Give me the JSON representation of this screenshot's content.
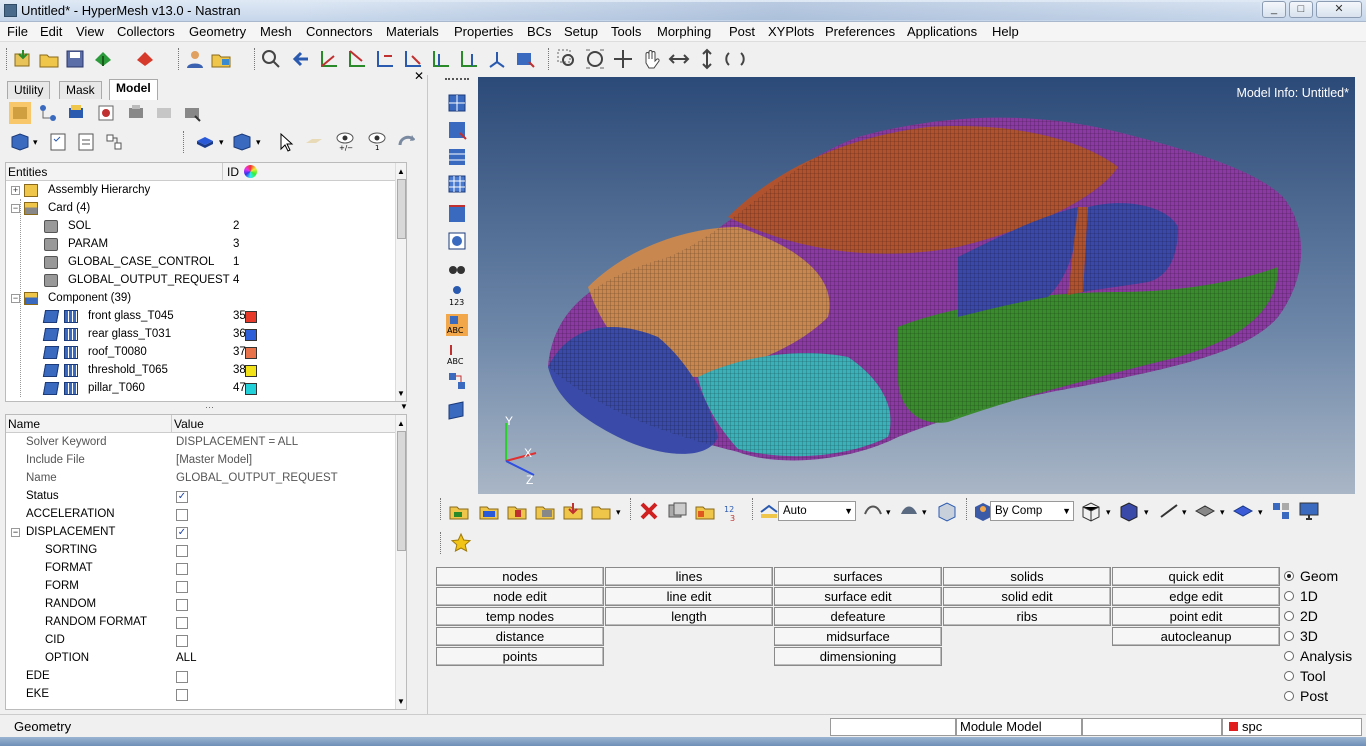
{
  "window": {
    "title": "Untitled* - HyperMesh v13.0 - Nastran",
    "min": "_",
    "max": "□",
    "close": "✕"
  },
  "menu": [
    "File",
    "Edit",
    "View",
    "Collectors",
    "Geometry",
    "Mesh",
    "Connectors",
    "Materials",
    "Properties",
    "BCs",
    "Setup",
    "Tools",
    "Morphing",
    "Post",
    "XYPlots",
    "Preferences",
    "Applications",
    "Help"
  ],
  "browser": {
    "tabs": [
      "Utility",
      "Mask",
      "Model"
    ],
    "active_tab": "Model",
    "close": "✕",
    "tree_headers": {
      "entities": "Entities",
      "id": "ID"
    },
    "tree": [
      {
        "exp": "+",
        "label": "Assembly Hierarchy",
        "id": "",
        "color": null,
        "level": 0,
        "icon": "assembly-icon"
      },
      {
        "exp": "−",
        "label": "Card (4)",
        "id": "",
        "color": null,
        "level": 0,
        "icon": "folder-icon"
      },
      {
        "exp": "",
        "label": "SOL",
        "id": "2",
        "color": null,
        "level": 1,
        "icon": "card-icon"
      },
      {
        "exp": "",
        "label": "PARAM",
        "id": "3",
        "color": null,
        "level": 1,
        "icon": "card-icon"
      },
      {
        "exp": "",
        "label": "GLOBAL_CASE_CONTROL",
        "id": "1",
        "color": null,
        "level": 1,
        "icon": "card-icon"
      },
      {
        "exp": "",
        "label": "GLOBAL_OUTPUT_REQUEST",
        "id": "4",
        "color": null,
        "level": 1,
        "icon": "card-icon"
      },
      {
        "exp": "−",
        "label": "Component (39)",
        "id": "",
        "color": null,
        "level": 0,
        "icon": "component-folder-icon"
      },
      {
        "exp": "",
        "label": "front glass_T045",
        "id": "35",
        "color": "#e83a2a",
        "level": 2,
        "icon": "component-icon"
      },
      {
        "exp": "",
        "label": "rear glass_T031",
        "id": "36",
        "color": "#2f5fd8",
        "level": 2,
        "icon": "component-icon"
      },
      {
        "exp": "",
        "label": "roof_T0080",
        "id": "37",
        "color": "#e8734a",
        "level": 2,
        "icon": "component-icon"
      },
      {
        "exp": "",
        "label": "threshold_T065",
        "id": "38",
        "color": "#f2e21a",
        "level": 2,
        "icon": "component-icon"
      },
      {
        "exp": "",
        "label": "pillar_T060",
        "id": "47",
        "color": "#21d0d8",
        "level": 2,
        "icon": "component-icon"
      }
    ],
    "prop_headers": {
      "name": "Name",
      "value": "Value"
    },
    "props": [
      {
        "name": "Solver Keyword",
        "value": "DISPLACEMENT = ALL",
        "type": "text",
        "indent": 1,
        "dim": true
      },
      {
        "name": "Include File",
        "value": "[Master Model]",
        "type": "text",
        "indent": 1,
        "dim": true
      },
      {
        "name": "Name",
        "value": "GLOBAL_OUTPUT_REQUEST",
        "type": "text",
        "indent": 1,
        "dim": true
      },
      {
        "name": "Status",
        "value": "✓",
        "type": "check",
        "indent": 1,
        "dim": false
      },
      {
        "name": "ACCELERATION",
        "value": "",
        "type": "check",
        "indent": 1,
        "dim": false
      },
      {
        "name": "DISPLACEMENT",
        "value": "✓",
        "type": "check",
        "indent": 1,
        "dim": false,
        "exp": "−"
      },
      {
        "name": "SORTING",
        "value": "",
        "type": "check",
        "indent": 2,
        "dim": false
      },
      {
        "name": "FORMAT",
        "value": "",
        "type": "check",
        "indent": 2,
        "dim": false
      },
      {
        "name": "FORM",
        "value": "",
        "type": "check",
        "indent": 2,
        "dim": false
      },
      {
        "name": "RANDOM",
        "value": "",
        "type": "check",
        "indent": 2,
        "dim": false
      },
      {
        "name": "RANDOM FORMAT",
        "value": "",
        "type": "check",
        "indent": 2,
        "dim": false
      },
      {
        "name": "CID",
        "value": "",
        "type": "check",
        "indent": 2,
        "dim": false
      },
      {
        "name": "OPTION",
        "value": "ALL",
        "type": "text",
        "indent": 2,
        "dim": false
      },
      {
        "name": "EDE",
        "value": "",
        "type": "check",
        "indent": 1,
        "dim": false
      },
      {
        "name": "EKE",
        "value": "",
        "type": "check",
        "indent": 1,
        "dim": false
      }
    ]
  },
  "viewport": {
    "model_info": "Model Info: Untitled*",
    "axis_labels": {
      "y": "Y",
      "x": "X",
      "z": "Z"
    }
  },
  "bottom_toolbar": {
    "shading_combo": "Auto",
    "color_combo": "By Comp"
  },
  "panel_buttons": [
    [
      "nodes",
      "lines",
      "surfaces",
      "solids",
      "quick edit"
    ],
    [
      "node edit",
      "line edit",
      "surface edit",
      "solid edit",
      "edge edit"
    ],
    [
      "temp nodes",
      "length",
      "defeature",
      "ribs",
      "point edit"
    ],
    [
      "distance",
      "",
      "midsurface",
      "",
      "autocleanup"
    ],
    [
      "points",
      "",
      "dimensioning",
      "",
      ""
    ]
  ],
  "page_radios": [
    {
      "label": "Geom",
      "selected": true
    },
    {
      "label": "1D",
      "selected": false
    },
    {
      "label": "2D",
      "selected": false
    },
    {
      "label": "3D",
      "selected": false
    },
    {
      "label": "Analysis",
      "selected": false
    },
    {
      "label": "Tool",
      "selected": false
    },
    {
      "label": "Post",
      "selected": false
    }
  ],
  "status": {
    "left": "Geometry",
    "module": "Module Model",
    "collector": "spc",
    "collector_color": "#e01e1e"
  }
}
